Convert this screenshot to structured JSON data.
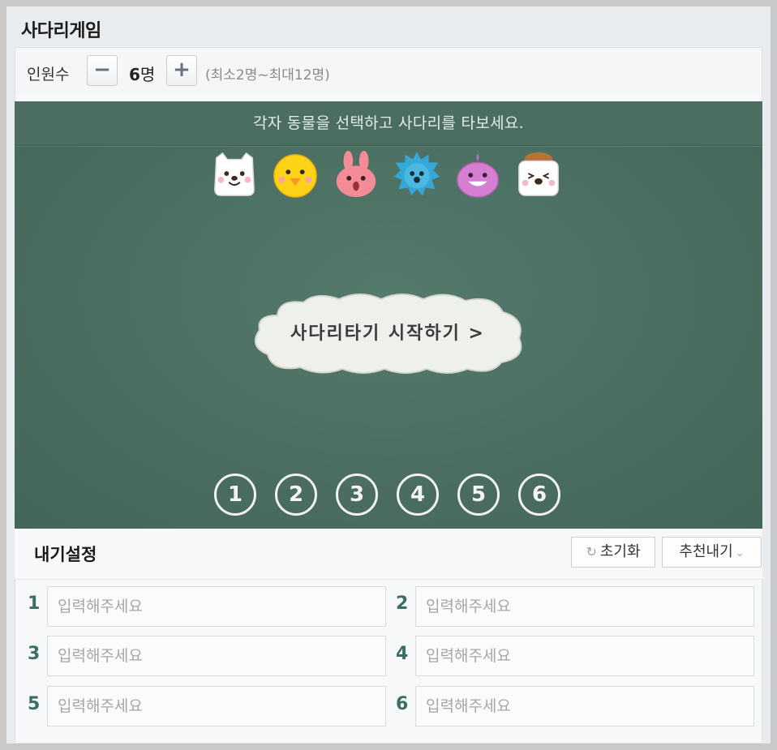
{
  "title": "사다리게임",
  "count": {
    "label": "인원수",
    "minus": "−",
    "plus": "+",
    "value": "6",
    "unit": "명",
    "range": "(최소2명~최대12명)"
  },
  "board": {
    "instruction": "각자 동물을 선택하고 사다리를 타보세요.",
    "animals": [
      "cat-icon",
      "chick-icon",
      "rabbit-icon",
      "hedgehog-icon",
      "whale-icon",
      "dog-icon"
    ],
    "start_button": "사다리타기 시작하기 >",
    "numbers": [
      "1",
      "2",
      "3",
      "4",
      "5",
      "6"
    ]
  },
  "settings": {
    "title": "내기설정",
    "reset_button": "초기화",
    "recommend_button": "추천내기",
    "fields": [
      {
        "number": "1",
        "placeholder": "입력해주세요"
      },
      {
        "number": "2",
        "placeholder": "입력해주세요"
      },
      {
        "number": "3",
        "placeholder": "입력해주세요"
      },
      {
        "number": "4",
        "placeholder": "입력해주세요"
      },
      {
        "number": "5",
        "placeholder": "입력해주세요"
      },
      {
        "number": "6",
        "placeholder": "입력해주세요"
      }
    ]
  },
  "colors": {
    "board": "#4b6e61",
    "label_accent": "#3e6d63"
  }
}
